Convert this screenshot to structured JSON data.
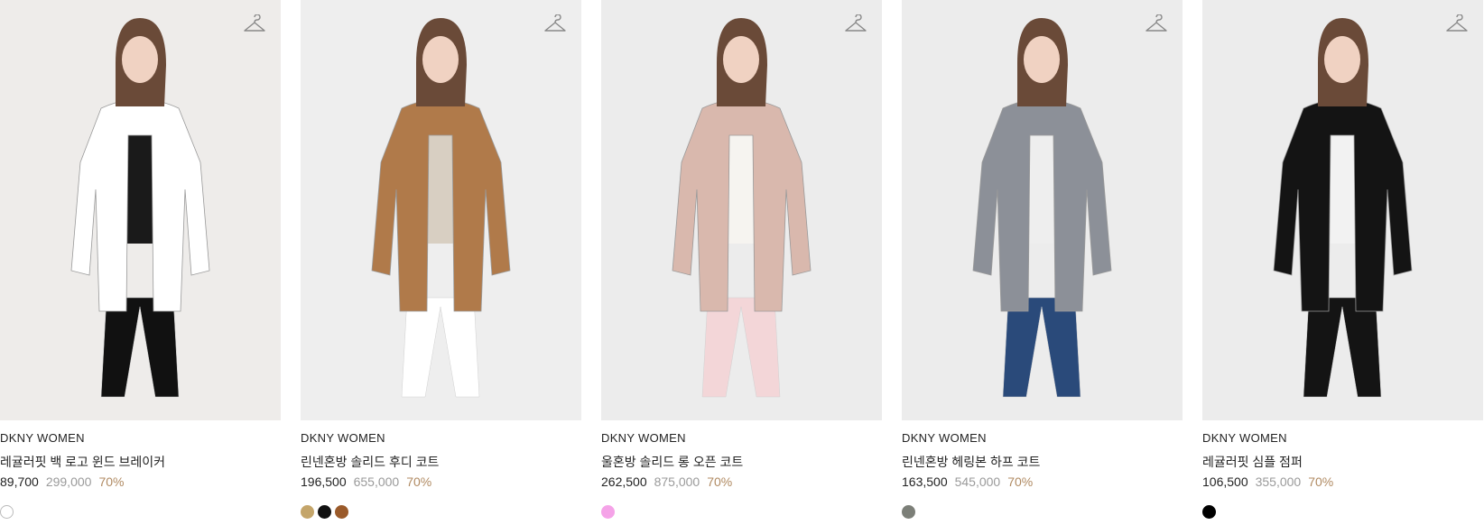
{
  "products": [
    {
      "brand": "DKNY WOMEN",
      "name": "레귤러핏 백 로고 윈드 브레이커",
      "sale_price": "89,700",
      "original_price": "299,000",
      "discount": "70%",
      "swatches": [
        "#ffffff"
      ],
      "background": "#eeecea",
      "garment_color": "#ffffff",
      "inner_color": "#1a1a1a",
      "bottom_color": "#111111"
    },
    {
      "brand": "DKNY WOMEN",
      "name": "린넨혼방 솔리드 후디 코트",
      "sale_price": "196,500",
      "original_price": "655,000",
      "discount": "70%",
      "swatches": [
        "#c4a56a",
        "#111111",
        "#9a5a2a"
      ],
      "background": "#eeeeee",
      "garment_color": "#b07a4a",
      "inner_color": "#d8cfc2",
      "bottom_color": "#ffffff"
    },
    {
      "brand": "DKNY WOMEN",
      "name": "울혼방 솔리드 롱 오픈 코트",
      "sale_price": "262,500",
      "original_price": "875,000",
      "discount": "70%",
      "swatches": [
        "#f5a3e8"
      ],
      "background": "#ececec",
      "garment_color": "#d9b8ad",
      "inner_color": "#f6f4f0",
      "bottom_color": "#f3d6d8"
    },
    {
      "brand": "DKNY WOMEN",
      "name": "린넨혼방 헤링본 하프 코트",
      "sale_price": "163,500",
      "original_price": "545,000",
      "discount": "70%",
      "swatches": [
        "#7c7f78"
      ],
      "background": "#ececec",
      "garment_color": "#8c9098",
      "inner_color": "#eeeeee",
      "bottom_color": "#2a4a7a"
    },
    {
      "brand": "DKNY WOMEN",
      "name": "레귤러핏 심플 점퍼",
      "sale_price": "106,500",
      "original_price": "355,000",
      "discount": "70%",
      "swatches": [
        "#000000"
      ],
      "background": "#ececec",
      "garment_color": "#141414",
      "inner_color": "#f2f2f2",
      "bottom_color": "#141414"
    }
  ]
}
